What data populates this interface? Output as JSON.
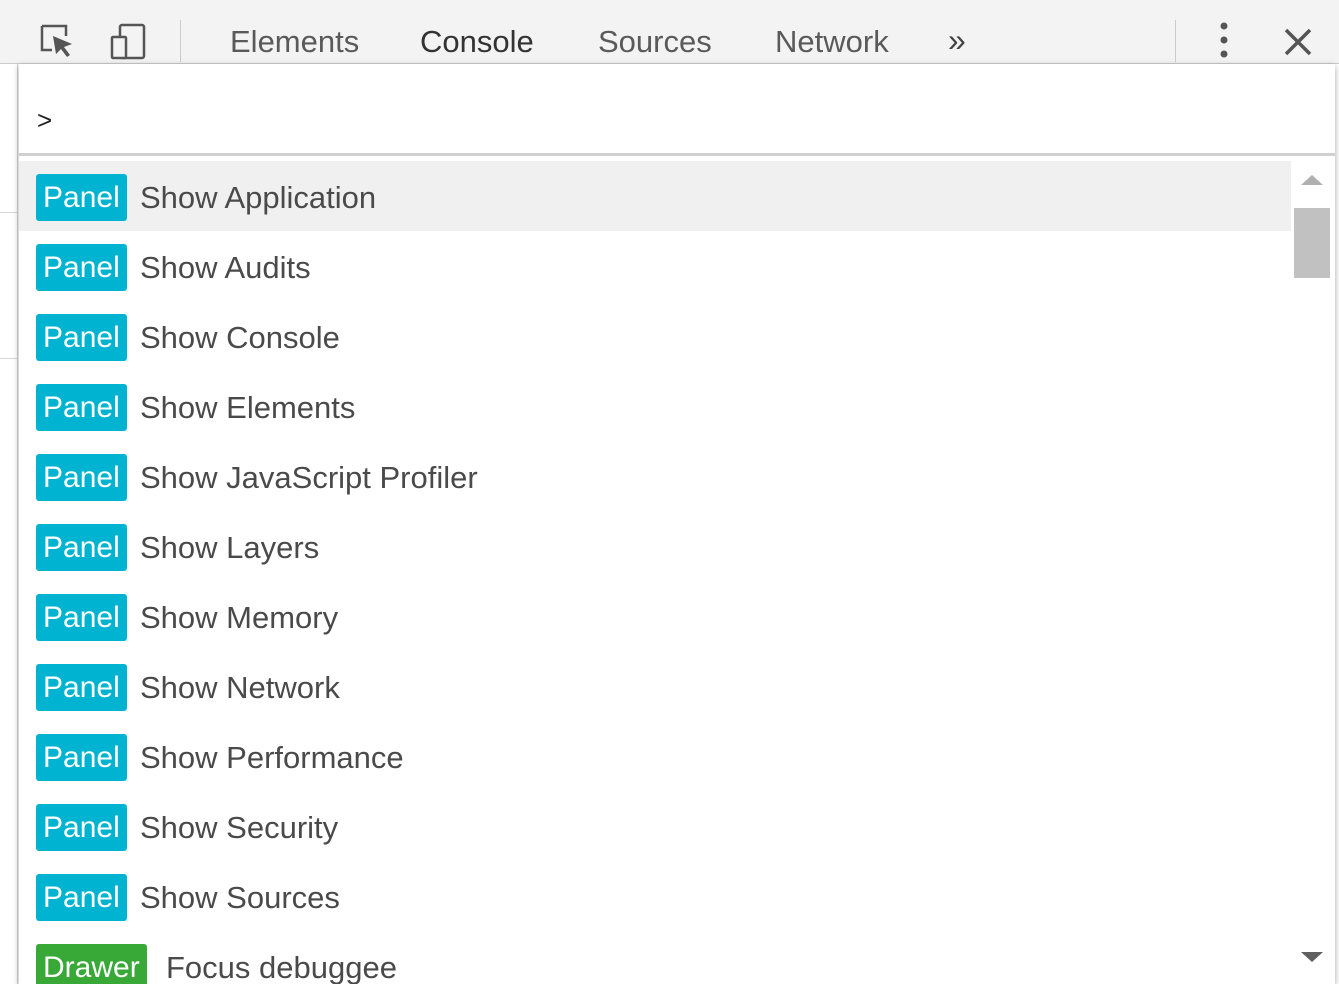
{
  "toolbar": {
    "tabs": [
      {
        "label": "Elements",
        "active": false
      },
      {
        "label": "Console",
        "active": true
      },
      {
        "label": "Sources",
        "active": false
      },
      {
        "label": "Network",
        "active": false
      }
    ],
    "more_tabs_label": "»",
    "icons": {
      "inspect": "inspect-element-icon",
      "device": "device-toolbar-icon",
      "menu": "more-options-icon",
      "close": "close-icon"
    }
  },
  "command_menu": {
    "prompt_value": ">",
    "items": [
      {
        "badge": "Panel",
        "label": "Show Application",
        "selected": true
      },
      {
        "badge": "Panel",
        "label": "Show Audits"
      },
      {
        "badge": "Panel",
        "label": "Show Console"
      },
      {
        "badge": "Panel",
        "label": "Show Elements"
      },
      {
        "badge": "Panel",
        "label": "Show JavaScript Profiler"
      },
      {
        "badge": "Panel",
        "label": "Show Layers"
      },
      {
        "badge": "Panel",
        "label": "Show Memory"
      },
      {
        "badge": "Panel",
        "label": "Show Network"
      },
      {
        "badge": "Panel",
        "label": "Show Performance"
      },
      {
        "badge": "Panel",
        "label": "Show Security"
      },
      {
        "badge": "Panel",
        "label": "Show Sources"
      },
      {
        "badge": "Drawer",
        "label": "Focus debuggee"
      }
    ]
  },
  "colors": {
    "panel_badge": "#00b4d1",
    "drawer_badge": "#38a837",
    "selected_row": "#f0f0f0"
  }
}
